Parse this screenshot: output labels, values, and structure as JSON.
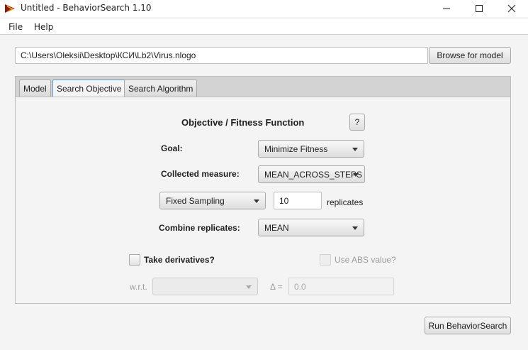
{
  "window": {
    "title": "Untitled - BehaviorSearch 1.10",
    "app_icon": "behaviorsearch-logo-icon",
    "controls": [
      "minimize-icon",
      "maximize-icon",
      "close-icon"
    ]
  },
  "menu": {
    "items": [
      "File",
      "Help"
    ]
  },
  "model_path": {
    "value": "C:\\Users\\Oleksii\\Desktop\\КСИ\\Lb2\\Virus.nlogo",
    "browse_label": "Browse for model"
  },
  "tabs": [
    {
      "label": "Model",
      "active": false
    },
    {
      "label": "Search Objective",
      "active": true
    },
    {
      "label": "Search Algorithm",
      "active": false
    }
  ],
  "objective": {
    "heading": "Objective / Fitness Function",
    "help_label": "?",
    "goal_label": "Goal:",
    "goal_value": "Minimize Fitness",
    "collected_label": "Collected measure:",
    "collected_value": "MEAN_ACROSS_STEPS",
    "sampling_value": "Fixed Sampling",
    "replicates_value": "10",
    "replicates_label": "replicates",
    "combine_label": "Combine replicates:",
    "combine_value": "MEAN",
    "derivatives_label": "Take derivatives?",
    "derivatives_checked": false,
    "abs_label": "Use ABS value?",
    "abs_checked": false,
    "wrt_label": "w.r.t.",
    "wrt_value": "",
    "delta_label": "Δ =",
    "delta_value": "0.0"
  },
  "run_label": "Run BehaviorSearch",
  "colors": {
    "active_tab_border": "#5f9ad3",
    "disabled_text": "#9c9c9c"
  }
}
